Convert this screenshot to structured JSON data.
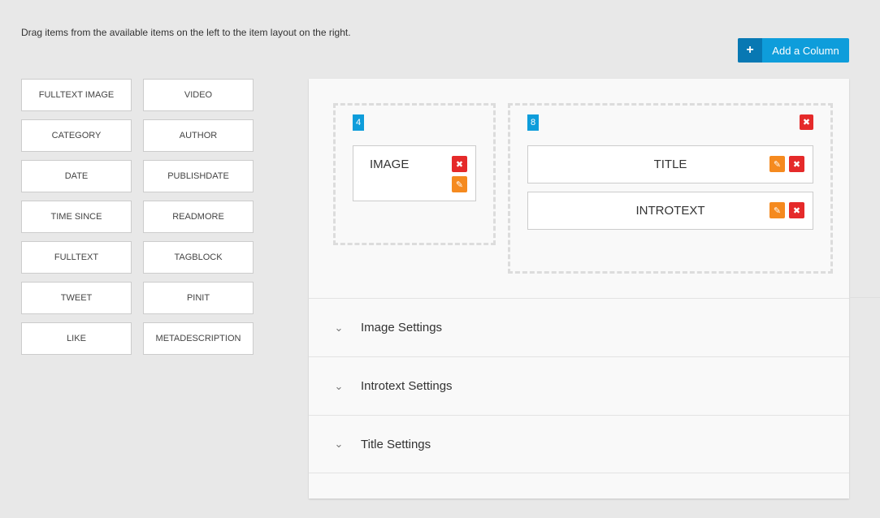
{
  "instructions": "Drag items from the available items on the left to the item layout on the right.",
  "add_column": {
    "icon": "plus-icon",
    "glyph": "+",
    "label": "Add a Column"
  },
  "palette": [
    "FULLTEXT IMAGE",
    "VIDEO",
    "CATEGORY",
    "AUTHOR",
    "DATE",
    "PUBLISHDATE",
    "TIME SINCE",
    "READMORE",
    "FULLTEXT",
    "TAGBLOCK",
    "TWEET",
    "PINIT",
    "LIKE",
    "METADESCRIPTION"
  ],
  "columns": [
    {
      "size": "4",
      "items": [
        {
          "label": "IMAGE"
        }
      ]
    },
    {
      "size": "8",
      "items": [
        {
          "label": "TITLE"
        },
        {
          "label": "INTROTEXT"
        }
      ]
    }
  ],
  "icons": {
    "remove": "✖",
    "edit": "✎",
    "chevron": "⌄"
  },
  "settings": [
    {
      "label": "Image Settings"
    },
    {
      "label": "Introtext Settings"
    },
    {
      "label": "Title Settings"
    }
  ],
  "colors": {
    "accent": "#0e9ddb",
    "accent_dark": "#0878b3",
    "remove": "#e52a2a",
    "edit": "#f58a1f"
  }
}
